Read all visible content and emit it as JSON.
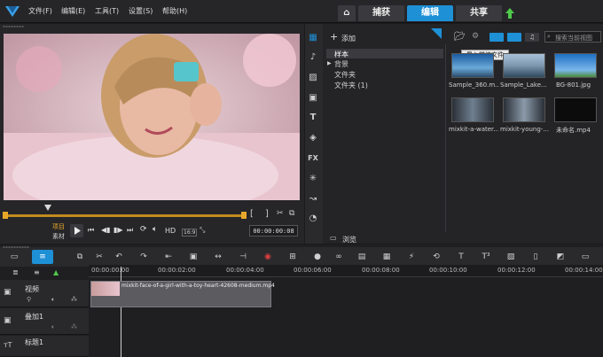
{
  "menu": [
    "文件(F)",
    "编辑(E)",
    "工具(T)",
    "设置(S)",
    "帮助(H)"
  ],
  "tabs": {
    "home": "⌂",
    "capture": "捕获",
    "edit": "编辑",
    "share": "共享"
  },
  "player": {
    "project_label": "项目",
    "clip_label": "素材",
    "hd_label": "HD",
    "timecode": "00:00:00:08",
    "scale": "16:9"
  },
  "library": {
    "add_label": "添加",
    "folders": [
      "样本",
      "背景",
      "文件夹",
      "文件夹 (1)"
    ],
    "tooltip": "导入媒体文件",
    "search_placeholder": "搜索当前视图",
    "browse_label": "浏览",
    "thumbs": [
      {
        "name": "Sample_360.m...",
        "color": "#2f7fc2"
      },
      {
        "name": "Sample_Lake...",
        "color": "#6e8ca6"
      },
      {
        "name": "BG-801.jpg",
        "color": "#3a86d4"
      },
      {
        "name": "mixkit-a-water...",
        "color": "#50606e"
      },
      {
        "name": "mixkit-young-...",
        "color": "#6a7a8c"
      },
      {
        "name": "未命名.mp4",
        "color": "#111111"
      }
    ]
  },
  "timeline": {
    "ruler": [
      "00:00:00:00",
      "00:00:02:00",
      "00:00:04:00",
      "00:00:06:00",
      "00:00:08:00",
      "00:00:10:00",
      "00:00:12:00",
      "00:00:14:00"
    ],
    "tracks": [
      "视频",
      "叠加1",
      "标题1"
    ],
    "clip_name": "mixkit-face-of-a-girl-with-a-toy-heart-42608-medium.mp4"
  },
  "colors": {
    "accent": "#1e90d6",
    "bg": "#1b1b1d",
    "panel": "#262629"
  }
}
